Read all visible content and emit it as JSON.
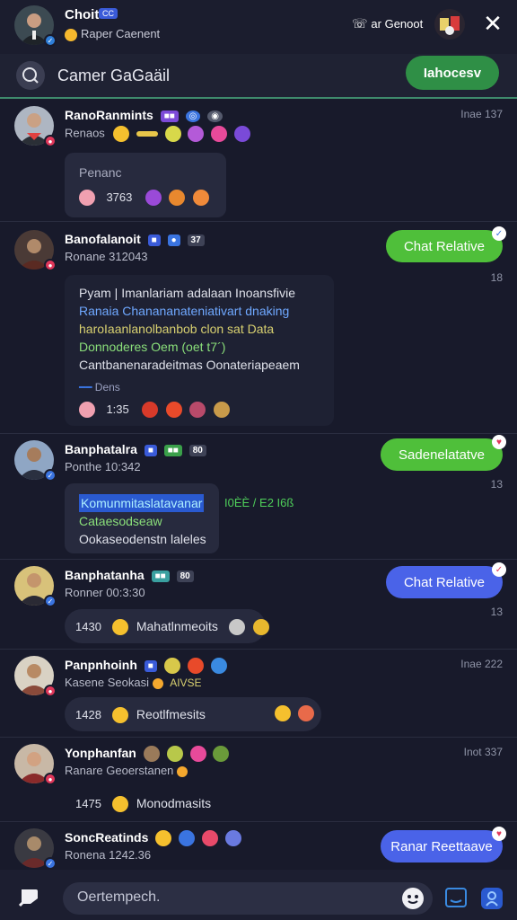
{
  "header": {
    "name": "Choit",
    "tag": "CC",
    "status": "Raper Caenent",
    "action_label": "ar Genoot"
  },
  "search": {
    "text": "Camer GaGaäil",
    "button_label": "Iahocesv"
  },
  "messages": [
    {
      "name": "RanoRanmints",
      "subtitle": "Renaos",
      "time": "Inae 137",
      "bubble": {
        "title": "Penanc",
        "count": "3763"
      }
    },
    {
      "name": "Banofalanoit",
      "tag": "37",
      "subtitle": "Ronane 312043",
      "pill": "Chat Relative",
      "pill_time": "18",
      "lines": [
        "Pyam | Imanlariam adalaan Inoansfivie",
        "Ranaia  Chanananateniativart  dnaking",
        "haroIaanlanolbanbob  clon sat Data",
        "Donnoderes  Oem (oet t7´)",
        "Cantbanenaradeitmas Oonateriapeaem"
      ],
      "foot_label": "Dens",
      "count": "1:35"
    },
    {
      "name": "Banphatalra",
      "tag": "80",
      "subtitle": "Ponthe 10:342",
      "pill": "Sadenelatatve",
      "pill_time": "13",
      "lines": [
        "Komunmitaslatavanar",
        "Cataesodseaw",
        "Ookaseodenstn laleles"
      ],
      "aside": "I0ÈÈ / E2 I6ß"
    },
    {
      "name": "Banphatanha",
      "tag": "80",
      "subtitle": "Ronner 00:3:30",
      "pill": "Chat Relative",
      "pill_time": "13",
      "count": "1430",
      "inline_text": "Mahatlnmeoits"
    },
    {
      "name": "Panpnhoinh",
      "subtitle": "Kasene Seokasi",
      "subtitle_suffix": "AIVSE",
      "time": "Inae 222",
      "count": "1428",
      "inline_text": "Reotlfmesits"
    },
    {
      "name": "Yonphanfan",
      "subtitle": "Ranare Geoerstanen",
      "time": "Inot 337",
      "count": "1475",
      "inline_text": "Monodmasits"
    },
    {
      "name": "SoncReatinds",
      "subtitle": "Ronena 1242.36",
      "pill": "Ranar Reettaave"
    }
  ],
  "compose": {
    "placeholder": "Oertempech."
  }
}
